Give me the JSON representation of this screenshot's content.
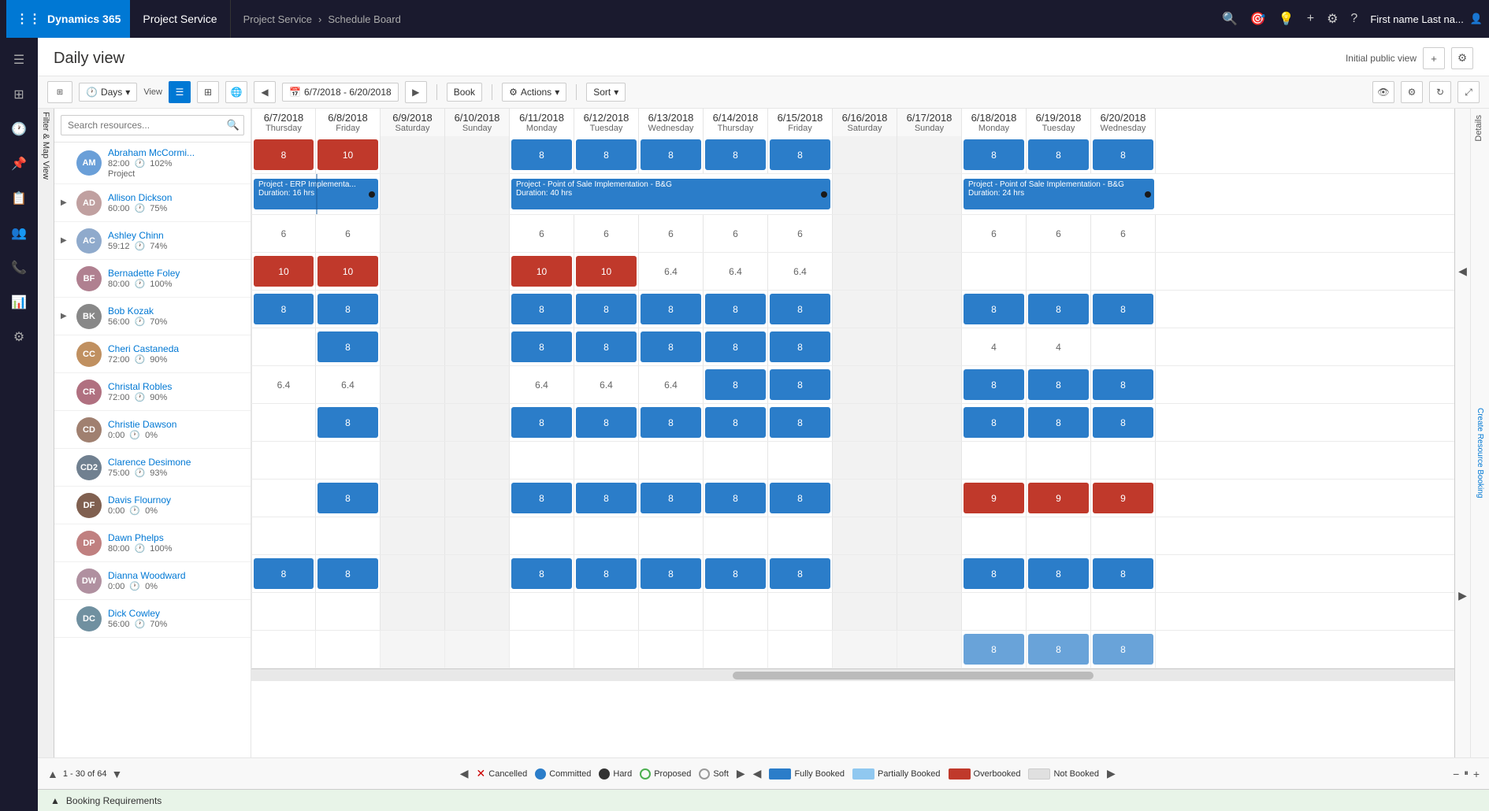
{
  "topNav": {
    "brand": "Dynamics 365",
    "app": "Project Service",
    "breadcrumb": [
      "Project Service",
      "Schedule Board"
    ],
    "user": "First name Last na..."
  },
  "pageHeader": {
    "title": "Daily view",
    "initialPublicView": "Initial public view"
  },
  "toolbar": {
    "days": "Days",
    "view": "View",
    "dateRange": "6/7/2018 - 6/20/2018",
    "book": "Book",
    "actions": "Actions",
    "sort": "Sort"
  },
  "search": {
    "placeholder": "Search resources..."
  },
  "dates": [
    {
      "date": "6/7/2018",
      "day": "Thursday",
      "weekend": false
    },
    {
      "date": "6/8/2018",
      "day": "Friday",
      "weekend": false
    },
    {
      "date": "6/9/2018",
      "day": "Saturday",
      "weekend": true
    },
    {
      "date": "6/10/2018",
      "day": "Sunday",
      "weekend": true
    },
    {
      "date": "6/11/2018",
      "day": "Monday",
      "weekend": false
    },
    {
      "date": "6/12/2018",
      "day": "Tuesday",
      "weekend": false
    },
    {
      "date": "6/13/2018",
      "day": "Wednesday",
      "weekend": false
    },
    {
      "date": "6/14/2018",
      "day": "Thursday",
      "weekend": false
    },
    {
      "date": "6/15/2018",
      "day": "Friday",
      "weekend": false
    },
    {
      "date": "6/16/2018",
      "day": "Saturday",
      "weekend": true
    },
    {
      "date": "6/17/2018",
      "day": "Sunday",
      "weekend": true
    },
    {
      "date": "6/18/2018",
      "day": "Monday",
      "weekend": false
    },
    {
      "date": "6/19/2018",
      "day": "Tuesday",
      "weekend": false
    },
    {
      "date": "6/20/2018",
      "day": "Wednesday",
      "weekend": false
    }
  ],
  "resources": [
    {
      "name": "Abraham McCormi...",
      "hours": "82:00",
      "util": "102%",
      "sub": "Project",
      "avatar": "AM",
      "hasExpand": false,
      "cells": [
        8,
        10,
        "",
        "",
        8,
        8,
        8,
        8,
        8,
        "",
        "",
        8,
        8,
        8
      ],
      "cellTypes": [
        "blue",
        "red",
        "w",
        "w",
        "blue",
        "blue",
        "blue",
        "blue",
        "blue",
        "w",
        "w",
        "blue",
        "blue",
        "blue"
      ],
      "projects": [
        {
          "name": "Project - ERP Implementa...",
          "duration": "Duration: 16 hrs",
          "start": 0,
          "span": 2,
          "type": "blue"
        },
        {
          "name": "Project - Point of Sale Implementation - B&G",
          "duration": "Duration: 40 hrs",
          "start": 4,
          "span": 5,
          "type": "blue"
        },
        {
          "name": "Project - Point of Sale Implementation - B&G",
          "duration": "Duration: 24 hrs",
          "start": 11,
          "span": 3,
          "type": "blue"
        }
      ]
    },
    {
      "name": "Allison Dickson",
      "hours": "60:00",
      "util": "75%",
      "avatar": "AD",
      "hasExpand": true,
      "cells": [
        6,
        6,
        "",
        "",
        6,
        6,
        6,
        6,
        6,
        "",
        "",
        6,
        6,
        6
      ],
      "cellTypes": [
        "t",
        "t",
        "w",
        "w",
        "t",
        "t",
        "t",
        "t",
        "t",
        "w",
        "w",
        "t",
        "t",
        "t"
      ]
    },
    {
      "name": "Ashley Chinn",
      "hours": "59:12",
      "util": "74%",
      "avatar": "AC",
      "hasExpand": true,
      "cells": [
        10,
        10,
        "",
        "",
        10,
        10,
        "6.4",
        "6.4",
        "6.4",
        "",
        "",
        "",
        "",
        ""
      ],
      "cellTypes": [
        "red",
        "red",
        "w",
        "w",
        "red",
        "red",
        "t",
        "t",
        "t",
        "w",
        "w",
        "t",
        "t",
        "t"
      ]
    },
    {
      "name": "Bernadette Foley",
      "hours": "80:00",
      "util": "100%",
      "avatar": "BF",
      "hasExpand": false,
      "cells": [
        8,
        8,
        "",
        "",
        8,
        8,
        8,
        8,
        8,
        "",
        "",
        8,
        8,
        8
      ],
      "cellTypes": [
        "blue",
        "blue",
        "w",
        "w",
        "blue",
        "blue",
        "blue",
        "blue",
        "blue",
        "w",
        "w",
        "blue",
        "blue",
        "blue"
      ]
    },
    {
      "name": "Bob Kozak",
      "hours": "56:00",
      "util": "70%",
      "avatar": "BK",
      "hasExpand": true,
      "cells": [
        "",
        8,
        "",
        "",
        8,
        8,
        8,
        8,
        8,
        "",
        "",
        4,
        4,
        ""
      ],
      "cellTypes": [
        "t",
        "blue",
        "w",
        "w",
        "blue",
        "blue",
        "blue",
        "blue",
        "blue",
        "w",
        "w",
        "t",
        "t",
        "t"
      ]
    },
    {
      "name": "Cheri Castaneda",
      "hours": "72:00",
      "util": "90%",
      "avatar": "CC",
      "hasExpand": false,
      "cells": [
        "6.4",
        "6.4",
        "",
        "",
        "6.4",
        "6.4",
        "6.4",
        8,
        8,
        "",
        "",
        8,
        8,
        8
      ],
      "cellTypes": [
        "t",
        "t",
        "w",
        "w",
        "t",
        "t",
        "t",
        "blue",
        "blue",
        "w",
        "w",
        "blue",
        "blue",
        "blue"
      ]
    },
    {
      "name": "Christal Robles",
      "hours": "72:00",
      "util": "90%",
      "avatar": "CR",
      "hasExpand": false,
      "cells": [
        "",
        8,
        "",
        "",
        8,
        8,
        8,
        8,
        8,
        "",
        "",
        8,
        8,
        8
      ],
      "cellTypes": [
        "t",
        "blue",
        "w",
        "w",
        "blue",
        "blue",
        "blue",
        "blue",
        "blue",
        "w",
        "w",
        "blue",
        "blue",
        "blue"
      ]
    },
    {
      "name": "Christie Dawson",
      "hours": "0:00",
      "util": "0%",
      "avatar": "CD",
      "hasExpand": false,
      "cells": [
        "",
        "",
        "",
        "",
        "",
        "",
        "",
        "",
        "",
        "",
        "",
        "",
        "",
        ""
      ],
      "cellTypes": [
        "t",
        "t",
        "w",
        "w",
        "t",
        "t",
        "t",
        "t",
        "t",
        "w",
        "w",
        "t",
        "t",
        "t"
      ]
    },
    {
      "name": "Clarence Desimone",
      "hours": "75:00",
      "util": "93%",
      "avatar": "CD2",
      "hasExpand": false,
      "cells": [
        "",
        8,
        "",
        "",
        8,
        8,
        8,
        8,
        8,
        "",
        "",
        9,
        9,
        9
      ],
      "cellTypes": [
        "t",
        "blue",
        "w",
        "w",
        "blue",
        "blue",
        "blue",
        "blue",
        "blue",
        "w",
        "w",
        "red",
        "red",
        "red"
      ]
    },
    {
      "name": "Davis Flournoy",
      "hours": "0:00",
      "util": "0%",
      "avatar": "DF",
      "hasExpand": false,
      "cells": [
        "",
        "",
        "",
        "",
        "",
        "",
        "",
        "",
        "",
        "",
        "",
        "",
        "",
        ""
      ],
      "cellTypes": [
        "t",
        "t",
        "w",
        "w",
        "t",
        "t",
        "t",
        "t",
        "t",
        "w",
        "w",
        "t",
        "t",
        "t"
      ]
    },
    {
      "name": "Dawn Phelps",
      "hours": "80:00",
      "util": "100%",
      "avatar": "DP",
      "hasExpand": false,
      "cells": [
        8,
        8,
        "",
        "",
        8,
        8,
        8,
        8,
        8,
        "",
        "",
        8,
        8,
        8
      ],
      "cellTypes": [
        "blue",
        "blue",
        "w",
        "w",
        "blue",
        "blue",
        "blue",
        "blue",
        "blue",
        "w",
        "w",
        "blue",
        "blue",
        "blue"
      ]
    },
    {
      "name": "Dianna Woodward",
      "hours": "0:00",
      "util": "0%",
      "avatar": "DW",
      "hasExpand": false,
      "cells": [
        "",
        "",
        "",
        "",
        "",
        "",
        "",
        "",
        "",
        "",
        "",
        "",
        "",
        ""
      ],
      "cellTypes": [
        "t",
        "t",
        "w",
        "w",
        "t",
        "t",
        "t",
        "t",
        "t",
        "w",
        "w",
        "t",
        "t",
        "t"
      ]
    },
    {
      "name": "Dick Cowley",
      "hours": "56:00",
      "util": "70%",
      "avatar": "DC",
      "hasExpand": false,
      "cells": [
        "",
        "",
        "",
        "",
        "",
        "",
        "",
        "",
        "",
        "",
        "",
        8,
        8,
        8
      ],
      "cellTypes": [
        "t",
        "t",
        "w",
        "w",
        "t",
        "t",
        "t",
        "t",
        "t",
        "w",
        "w",
        "blue",
        "blue",
        "blue"
      ]
    }
  ],
  "bottomBar": {
    "pager": "1 - 30 of 64",
    "legend": {
      "cancelled": "Cancelled",
      "committed": "Committed",
      "hard": "Hard",
      "proposed": "Proposed",
      "soft": "Soft",
      "fullyBooked": "Fully Booked",
      "partiallyBooked": "Partially Booked",
      "overbooked": "Overbooked",
      "notBooked": "Not Booked"
    }
  },
  "bookingReq": {
    "label": "Booking Requirements"
  },
  "sidebar": {
    "icons": [
      "☰",
      "⊞",
      "📋",
      "💬",
      "📁",
      "👤",
      "📞",
      "🔊"
    ]
  }
}
